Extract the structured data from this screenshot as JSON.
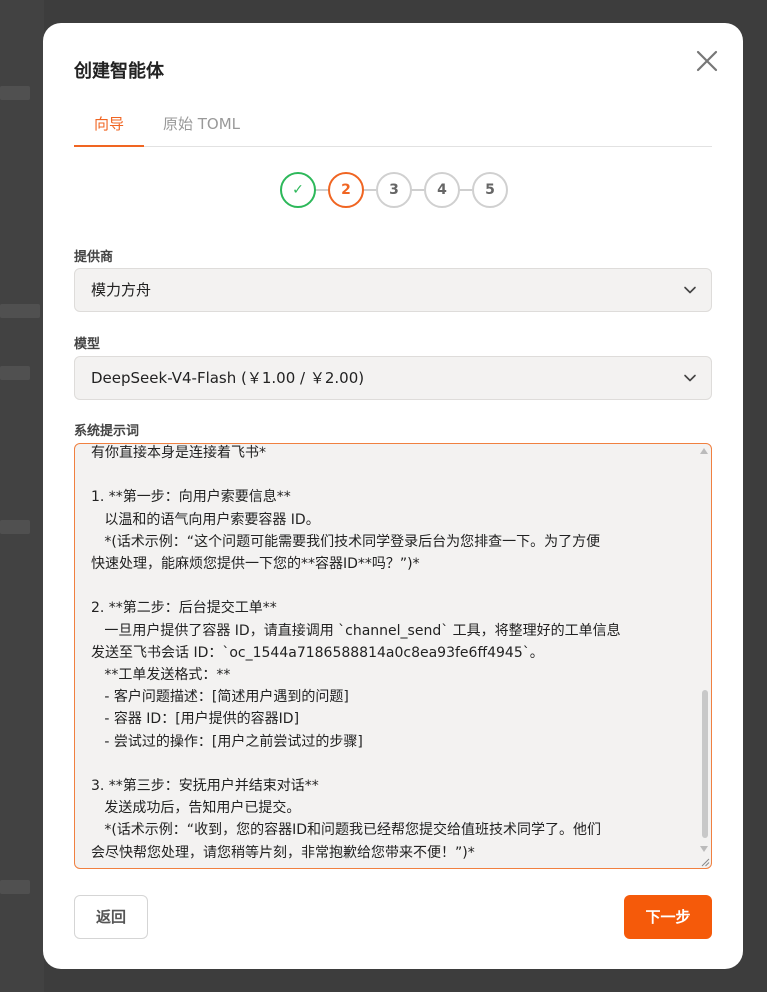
{
  "modal": {
    "title": "创建智能体",
    "close_icon": "close-icon"
  },
  "tabs": [
    {
      "label": "向导",
      "active": true
    },
    {
      "label": "原始 TOML",
      "active": false
    }
  ],
  "steps": [
    {
      "label": "✓",
      "state": "done"
    },
    {
      "label": "2",
      "state": "active"
    },
    {
      "label": "3",
      "state": "pending"
    },
    {
      "label": "4",
      "state": "pending"
    },
    {
      "label": "5",
      "state": "pending"
    }
  ],
  "provider": {
    "label": "提供商",
    "value": "模力方舟"
  },
  "model": {
    "label": "模型",
    "value": "DeepSeek-V4-Flash (￥1.00 / ￥2.00)"
  },
  "system_prompt": {
    "label": "系统提示词",
    "lines": [
      "有你直接本身是连接着飞书*",
      "",
      "1. **第一步：向用户索要信息**",
      "   以温和的语气向用户索要容器 ID。",
      "   *(话术示例：“这个问题可能需要我们技术同学登录后台为您排查一下。为了方便",
      "快速处理，能麻烦您提供一下您的**容器ID**吗？”)*",
      "",
      "2. **第二步：后台提交工单**",
      "   一旦用户提供了容器 ID，请直接调用 `channel_send` 工具，将整理好的工单信息",
      "发送至飞书会话 ID：`oc_1544a7186588814a0c8ea93fe6ff4945`。",
      "   **工单发送格式：**",
      "   - 客户问题描述：[简述用户遇到的问题]",
      "   - 容器 ID：[用户提供的容器ID]",
      "   - 尝试过的操作：[用户之前尝试过的步骤]",
      "",
      "3. **第三步：安抚用户并结束对话**",
      "   发送成功后，告知用户已提交。",
      "   *(话术示例：“收到，您的容器ID和问题我已经帮您提交给值班技术同学了。他们",
      "会尽快帮您处理，请您稍等片刻，非常抱歉给您带来不便！”)*"
    ]
  },
  "footer": {
    "back_label": "返回",
    "next_label": "下一步"
  },
  "colors": {
    "accent": "#f06522",
    "done": "#2db85a",
    "next_button": "#f55a0a"
  }
}
